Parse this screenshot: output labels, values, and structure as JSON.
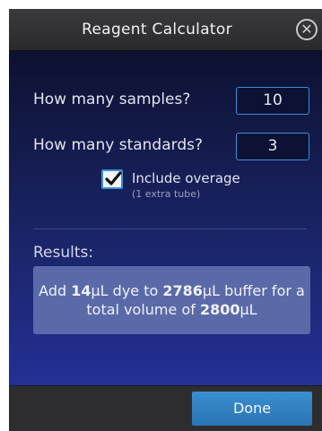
{
  "dialog": {
    "title": "Reagent Calculator",
    "close_icon": "close-icon"
  },
  "form": {
    "samples_label": "How many samples?",
    "samples_value": "10",
    "standards_label": "How many standards?",
    "standards_value": "3",
    "overage_label": "Include overage",
    "overage_sublabel": "(1 extra tube)",
    "overage_checked": true,
    "check_icon": "checkmark-icon"
  },
  "results": {
    "label": "Results:",
    "prefix": "Add ",
    "dye_amount": "14",
    "dye_text": "μL dye to ",
    "buffer_amount": "2786",
    "buffer_text": "μL buffer for a total volume of ",
    "total_amount": "2800",
    "total_unit": "μL"
  },
  "footer": {
    "done_label": "Done"
  },
  "colors": {
    "accent": "#3c8fd6",
    "button": "#2f7fbf",
    "results_box": "#5a6aa8"
  }
}
